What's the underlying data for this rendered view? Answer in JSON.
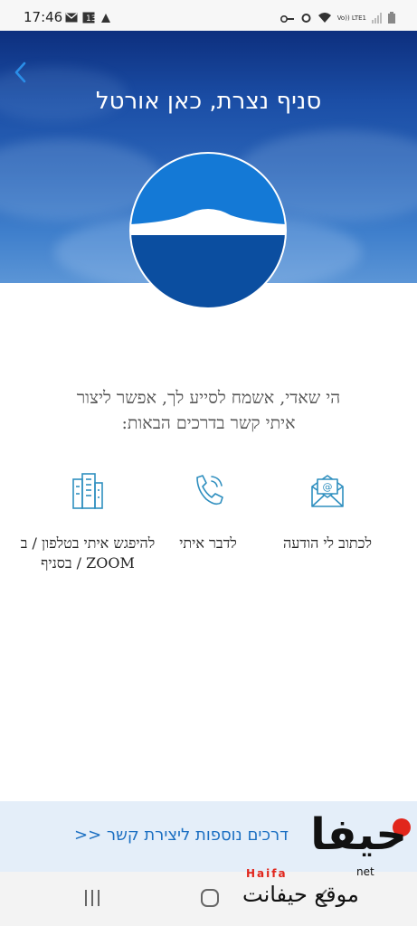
{
  "status_bar": {
    "time": "17:46",
    "left_icons": [
      "mail-icon",
      "app-badge-icon",
      "cloud-icon"
    ],
    "right_icons": [
      "key-icon",
      "alarm-icon",
      "wifi-icon",
      "volte-icon",
      "signal-icon",
      "battery-icon"
    ],
    "network_label": "Vo)) LTE1"
  },
  "header": {
    "back_icon": "chevron-left-icon",
    "title": "סניף נצרת, כאן אורטל"
  },
  "greeting": {
    "line1": "הי שאדי, אשמח לסייע לך, אפשר ליצור",
    "line2": "איתי קשר בדרכים הבאות:"
  },
  "options": [
    {
      "icon": "envelope-icon",
      "label": "לכתוב לי הודעה"
    },
    {
      "icon": "phone-icon",
      "label": "לדבר איתי"
    },
    {
      "icon": "building-icon",
      "label": "להיפגש איתי בטלפון / ב ZOOM / בסניף"
    }
  ],
  "more_link": "דרכים נוספות ליצירת קשר <<",
  "nav": {
    "recents_icon": "recents-icon",
    "home_icon": "home-icon",
    "back_icon": "back-icon"
  },
  "watermark": {
    "top": "حيفا",
    "latin": "Haifa",
    "net": "net",
    "bottom": "موقع حيفانت"
  },
  "colors": {
    "accent": "#1b6fc2",
    "hero_dark": "#0d2f7e",
    "logo_navy": "#0b4ea0",
    "icon_teal": "#2f8fbf",
    "watermark_red": "#e1261c"
  }
}
